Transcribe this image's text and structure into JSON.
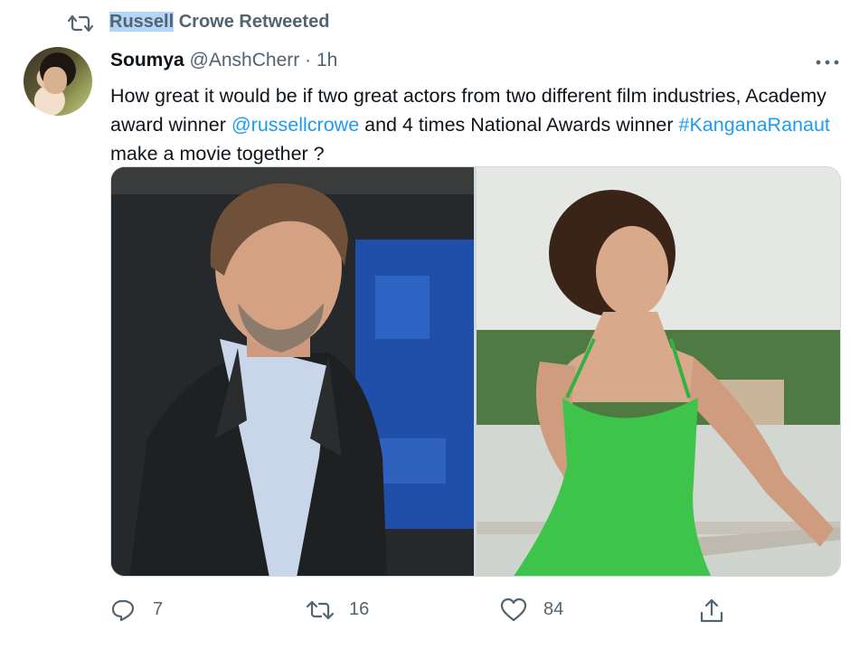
{
  "retweet_banner": {
    "highlighted_name": "Russell",
    "rest": " Crowe Retweeted"
  },
  "tweet": {
    "author_name": "Soumya",
    "handle": "@AnshCherr",
    "separator": "·",
    "time": "1h",
    "text": {
      "part1": "How great it would be if two great actors from two different film industries, Academy award winner ",
      "mention": "@russellcrowe",
      "part2": " and 4 times National Awards winner ",
      "hashtag": "#KanganaRanaut",
      "part3": " make a movie together ?"
    },
    "media": [
      {
        "kind": "photo",
        "subject": "man in dark suit jacket and light blue shirt"
      },
      {
        "kind": "photo",
        "subject": "woman in green dress by a railing"
      }
    ]
  },
  "actions": {
    "reply_count": "7",
    "retweet_count": "16",
    "like_count": "84"
  },
  "icons": {
    "retweet": "retweet-icon",
    "more": "more-icon",
    "reply": "reply-icon",
    "like": "heart-icon",
    "share": "share-icon"
  },
  "colors": {
    "link": "#1d9bf0",
    "secondary_text": "#536471",
    "selection": "#b4d5f5"
  }
}
